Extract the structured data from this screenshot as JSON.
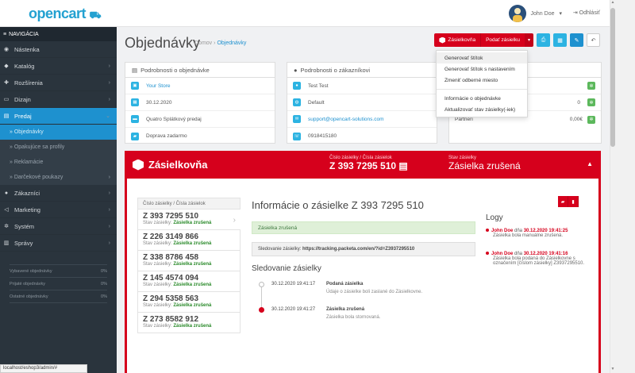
{
  "header": {
    "logo": "opencart",
    "user_name": "John Doe",
    "user_caret": "▾",
    "logout": "Odhlásiť"
  },
  "sidebar": {
    "nav_title": "NAVIGÁCIA",
    "items": [
      {
        "label": "Nástenka",
        "icon": "dashboard-icon",
        "glyph": "◉"
      },
      {
        "label": "Katalóg",
        "icon": "tag-icon",
        "glyph": "◆"
      },
      {
        "label": "Rozšírenia",
        "icon": "puzzle-icon",
        "glyph": "✚"
      },
      {
        "label": "Dizajn",
        "icon": "monitor-icon",
        "glyph": "▭"
      },
      {
        "label": "Predaj",
        "icon": "cart-icon",
        "glyph": "▤"
      }
    ],
    "sub_items": [
      {
        "label": "» Objednávky"
      },
      {
        "label": "» Opakujúce sa profily"
      },
      {
        "label": "» Reklamácie"
      },
      {
        "label": "» Darčekové poukazy"
      }
    ],
    "items2": [
      {
        "label": "Zákazníci",
        "icon": "user-icon",
        "glyph": "●"
      },
      {
        "label": "Marketing",
        "icon": "share-icon",
        "glyph": "◁"
      },
      {
        "label": "Systém",
        "icon": "cog-icon",
        "glyph": "✲"
      },
      {
        "label": "Správy",
        "icon": "chart-icon",
        "glyph": "▥"
      }
    ],
    "stats": [
      {
        "label": "Vybavené objednávky",
        "value": "0%"
      },
      {
        "label": "Prijaté objednávky",
        "value": "0%"
      },
      {
        "label": "Ostatné objednávky",
        "value": "0%"
      }
    ]
  },
  "status_url": "localhost/eshop3/admin/#",
  "page": {
    "title": "Objednávky",
    "crumb_home": "Domov",
    "crumb_sep": "›",
    "crumb_current": "Objednávky"
  },
  "toolbar": {
    "zasielkovna_label": "Zásielkovňa",
    "submit_label": "Podať zásielku",
    "caret": "▾",
    "print_glyph": "⎙",
    "ship_glyph": "▦",
    "edit_glyph": "✎",
    "back_glyph": "↶"
  },
  "dropdown": {
    "items": [
      "Generovať štítok",
      "Generovať štítok s nastavením",
      "Zmeniť odberné miesto"
    ],
    "items2": [
      "Informácie o objednávke",
      "Aktualizovať stav zásielky(-iek)"
    ]
  },
  "order_panel": {
    "title": "Podrobnosti o objednávke",
    "rows": [
      {
        "value": "Your Store",
        "link": true
      },
      {
        "value": "30.12.2020"
      },
      {
        "value": "Quatro Splátkový predaj"
      },
      {
        "value": "Doprava zadarmo"
      }
    ]
  },
  "customer_panel": {
    "title": "Podrobnosti o zákazníkovi",
    "rows": [
      {
        "value": "Test Test"
      },
      {
        "value": "Default"
      },
      {
        "value": "support@opencart-solutions.com",
        "link": true
      },
      {
        "value": "0918415180"
      }
    ]
  },
  "options_panel": {
    "rows": [
      {
        "label": "",
        "value": ""
      },
      {
        "label": "",
        "value": "0"
      },
      {
        "label": "Partneri",
        "value": "0,00€"
      }
    ]
  },
  "zasielkovna": {
    "brand": "Zásielkovňa",
    "num_label": "Číslo zásielky / Čísla zásielok",
    "num_value": "Z 393 7295 510",
    "status_label": "Stav zásielky",
    "status_value": "Zásielka zrušená",
    "collapse_glyph": "▲",
    "list_header": "Číslo zásielky / Čísla zásielok",
    "status_prefix": "Stav zásielky:",
    "shipments": [
      {
        "number": "Z 393 7295 510",
        "status": "Zásielka zrušená"
      },
      {
        "number": "Z 226 3149 866",
        "status": "Zásielka zrušená"
      },
      {
        "number": "Z 338 8786 458",
        "status": "Zásielka zrušená"
      },
      {
        "number": "Z 145 4574 094",
        "status": "Zásielka zrušená"
      },
      {
        "number": "Z 294 5358 563",
        "status": "Zásielka zrušená"
      },
      {
        "number": "Z 273 8582 912",
        "status": "Zásielka zrušená"
      }
    ],
    "info_title": "Informácie o zásielke Z 393 7295 510",
    "alert_status": "Zásielka zrušená",
    "tracking_label": "Sledovanie zásielky:",
    "tracking_url": "https://tracking.packeta.com/en/?id=Z3937295510",
    "tracking_title": "Sledovanie zásielky",
    "timeline": [
      {
        "time": "30.12.2020 19:41:17",
        "title": "Podaná zásielka",
        "desc": "Údaje o zásielke boli zaslané do Zásielkovne."
      },
      {
        "time": "30.12.2020 19:41:27",
        "title": "Zásielka zrušená",
        "desc": "Zásielka bola stornovaná."
      }
    ],
    "logs_title": "Logy",
    "logs": [
      {
        "who": "John Doe",
        "mid": " dňa ",
        "when": "30.12.2020 19:41:25",
        "text": "Zásielka bola manuálne zrušená."
      },
      {
        "who": "John Doe",
        "mid": " dňa ",
        "when": "30.12.2020 19:41:16",
        "text": "Zásielka bola podaná do Zásielkovne s označením [číslom zásielky] Z3937295510."
      }
    ]
  },
  "colors": {
    "brand_red": "#d6001c",
    "primary": "#1e91cf",
    "info": "#2cb3e2",
    "success": "#5cb85c"
  }
}
